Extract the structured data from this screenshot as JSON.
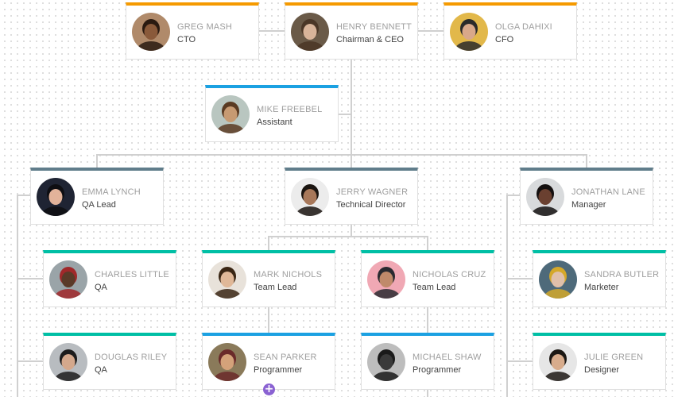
{
  "colors": {
    "executive": "#f59a00",
    "assistant": "#1ba1e2",
    "manager": "#607d8b",
    "staff": "#00bfa5",
    "programmer": "#1ba1e2",
    "add_button": "#8a62d2",
    "connector": "#d0d0d0"
  },
  "nodes": [
    {
      "id": "greg-mash",
      "name": "GREG MASH",
      "title": "CTO",
      "level": "executive",
      "avatar": {
        "bg": "#b08a6a",
        "skin": "#8a5a3a",
        "hair": "#2a1a10"
      }
    },
    {
      "id": "henry-bennett",
      "name": "HENRY BENNETT",
      "title": "Chairman & CEO",
      "level": "executive",
      "avatar": {
        "bg": "#6a5a48",
        "skin": "#d8b49a",
        "hair": "#4a3626"
      }
    },
    {
      "id": "olga-dahixi",
      "name": "OLGA DAHIXI",
      "title": "CFO",
      "level": "executive",
      "avatar": {
        "bg": "#e2b84a",
        "skin": "#d9a88a",
        "hair": "#2a2a2a"
      }
    },
    {
      "id": "mike-freebel",
      "name": "MIKE FREEBEL",
      "title": "Assistant",
      "level": "assistant",
      "avatar": {
        "bg": "#b9c6c0",
        "skin": "#c79a72",
        "hair": "#5a3a22"
      }
    },
    {
      "id": "emma-lynch",
      "name": "EMMA LYNCH",
      "title": "QA Lead",
      "level": "manager",
      "avatar": {
        "bg": "#1f2433",
        "skin": "#e2b39a",
        "hair": "#0e0e12"
      }
    },
    {
      "id": "jerry-wagner",
      "name": "JERRY WAGNER",
      "title": "Technical Director",
      "level": "manager",
      "avatar": {
        "bg": "#ececec",
        "skin": "#a8785a",
        "hair": "#1a1410"
      }
    },
    {
      "id": "jonathan-lane",
      "name": "JONATHAN LANE",
      "title": "Manager",
      "level": "manager",
      "avatar": {
        "bg": "#d8dadc",
        "skin": "#6a4030",
        "hair": "#141010"
      }
    },
    {
      "id": "charles-little",
      "name": "CHARLES LITTLE",
      "title": "QA",
      "level": "staff",
      "avatar": {
        "bg": "#9aa4a8",
        "skin": "#5a3a28",
        "hair": "#a0282a"
      }
    },
    {
      "id": "douglas-riley",
      "name": "DOUGLAS RILEY",
      "title": "QA",
      "level": "staff",
      "avatar": {
        "bg": "#b8bcc0",
        "skin": "#d4a88c",
        "hair": "#1c1c1c"
      }
    },
    {
      "id": "mark-nichols",
      "name": "MARK NICHOLS",
      "title": "Team Lead",
      "level": "staff",
      "avatar": {
        "bg": "#e8e2da",
        "skin": "#e0b898",
        "hair": "#3a2614"
      }
    },
    {
      "id": "nicholas-cruz",
      "name": "NICHOLAS CRUZ",
      "title": "Team Lead",
      "level": "staff",
      "avatar": {
        "bg": "#f0a8b4",
        "skin": "#c08a6a",
        "hair": "#2a2a30"
      }
    },
    {
      "id": "sandra-butler",
      "name": "SANDRA BUTLER",
      "title": "Marketer",
      "level": "staff",
      "avatar": {
        "bg": "#4e6a7a",
        "skin": "#e0c0aa",
        "hair": "#d4a82a"
      }
    },
    {
      "id": "julie-green",
      "name": "JULIE GREEN",
      "title": "Designer",
      "level": "staff",
      "avatar": {
        "bg": "#e6e6e6",
        "skin": "#d8ac8c",
        "hair": "#1c1814"
      }
    },
    {
      "id": "sean-parker",
      "name": "SEAN PARKER",
      "title": "Programmer",
      "level": "programmer",
      "avatar": {
        "bg": "#8a7a5a",
        "skin": "#d4a27a",
        "hair": "#6a2a2a"
      }
    },
    {
      "id": "michael-shaw",
      "name": "MICHAEL SHAW",
      "title": "Programmer",
      "level": "programmer",
      "avatar": {
        "bg": "#bdbdbd",
        "skin": "#3a3a3a",
        "hair": "#1a1a1a"
      }
    }
  ],
  "add_button": {
    "label": "+",
    "icon": "plus-icon"
  }
}
